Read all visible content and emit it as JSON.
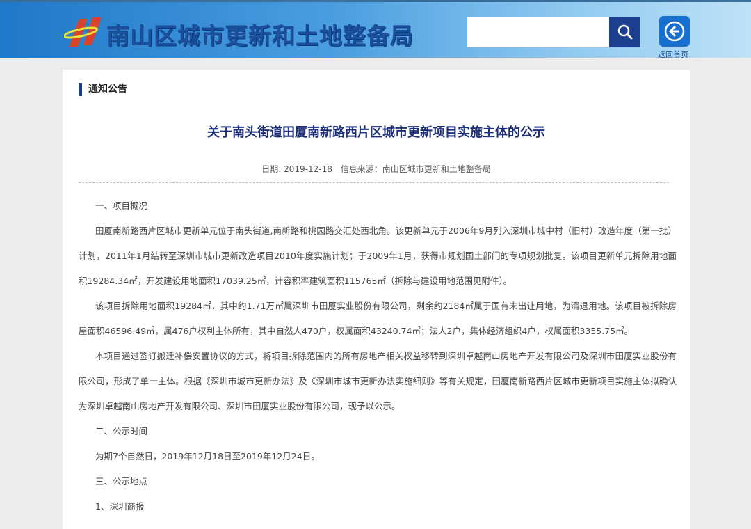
{
  "header": {
    "site_title": "南山区城市更新和土地整备局",
    "search_placeholder": "",
    "home_label": "返回首页"
  },
  "section": {
    "label": "通知公告"
  },
  "article": {
    "title": "关于南头街道田厦南新路西片区城市更新项目实施主体的公示",
    "date": "日期: 2019-12-18",
    "source": "信息来源：南山区城市更新和土地整备局",
    "paragraphs": [
      "一、项目概况",
      "田厦南新路西片区城市更新单元位于南头街道,南新路和桃园路交汇处西北角。该更新单元于2006年9月列入深圳市城中村（旧村）改造年度（第一批）计划，2011年1月结转至深圳市城市更新改造项目2010年度实施计划；于2009年1月，获得市规划国土部门的专项规划批复。该项目更新单元拆除用地面积19284.34㎡，开发建设用地面积17039.25㎡，计容积率建筑面积115765㎡（拆除与建设用地范围见附件）。",
      "该项目拆除用地面积19284㎡，其中约1.71万㎡属深圳市田厦实业股份有限公司，剩余约2184㎡属于国有未出让用地，为清退用地。该项目被拆除房屋面积46596.49㎡，属476户权利主体所有，其中自然人470户，权属面积43240.74㎡；法人2户，集体经济组织4户，权属面积3355.75㎡。",
      "本项目通过签订搬迁补偿安置协议的方式，将项目拆除范围内的所有房地产相关权益移转到深圳卓越南山房地产开发有限公司及深圳市田厦实业股份有限公司，形成了单一主体。根据《深圳市城市更新办法》及《深圳市城市更新办法实施细则》等有关规定，田厦南新路西片区城市更新项目实施主体拟确认为深圳卓越南山房地产开发有限公司、深圳市田厦实业股份有限公司，现予以公示。",
      "二、公示时间",
      "为期7个自然日，2019年12月18日至2019年12月24日。",
      "三、公示地点",
      "1、深圳商报"
    ]
  }
}
